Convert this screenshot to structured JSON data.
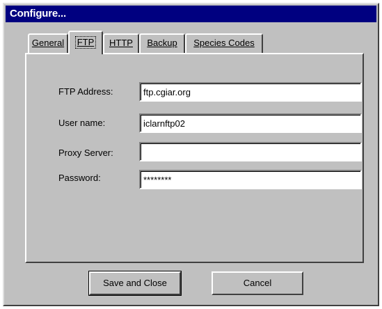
{
  "window": {
    "title": "Configure..."
  },
  "tabs": [
    {
      "label": "General",
      "active": false
    },
    {
      "label": "FTP",
      "active": true
    },
    {
      "label": "HTTP",
      "active": false
    },
    {
      "label": "Backup",
      "active": false
    },
    {
      "label": "Species Codes",
      "active": false
    }
  ],
  "form": {
    "ftp_address": {
      "label": "FTP Address:",
      "value": "ftp.cgiar.org"
    },
    "user_name": {
      "label": "User name:",
      "value": "iclarnftp02"
    },
    "proxy_server": {
      "label": "Proxy Server:",
      "value": ""
    },
    "password": {
      "label": "Password:",
      "value": "********"
    }
  },
  "buttons": {
    "save_close": "Save and Close",
    "cancel": "Cancel"
  },
  "colors": {
    "face": "#c0c0c0",
    "titlebar": "#000080",
    "title_text": "#ffffff"
  }
}
